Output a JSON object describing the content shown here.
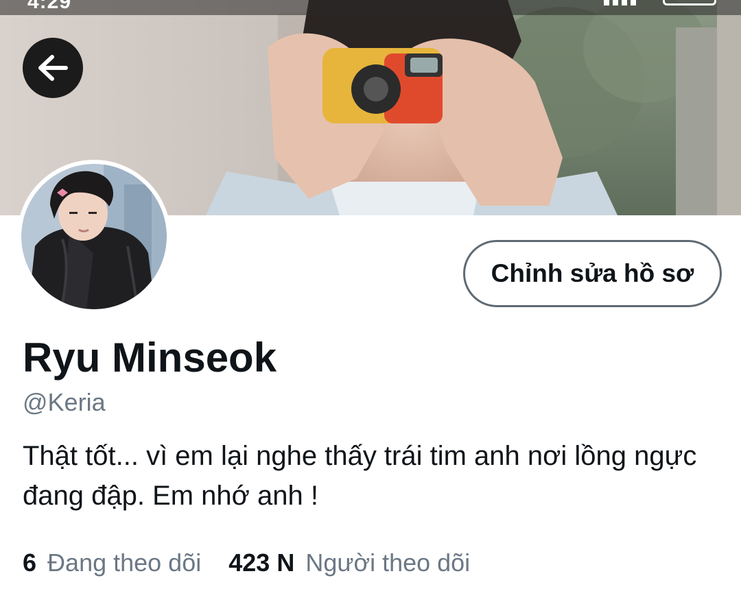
{
  "status_bar": {
    "time": "4:29"
  },
  "profile": {
    "display_name": "Ryu Minseok",
    "handle": "@Keria",
    "bio": "Thật tốt... vì em lại nghe thấy trái tim anh nơi lồng ngực đang đập. Em nhớ anh !",
    "edit_button_label": "Chỉnh sửa hồ sơ"
  },
  "stats": {
    "following_count": "6",
    "following_label": "Đang theo dõi",
    "followers_count": "423 N",
    "followers_label": "Người theo dõi"
  },
  "icons": {
    "back": "arrow-left-icon"
  },
  "colors": {
    "text_primary": "#0f1419",
    "text_secondary": "#6b7784",
    "button_border": "#5f6a73",
    "back_button_bg": "#1b1b1b"
  }
}
